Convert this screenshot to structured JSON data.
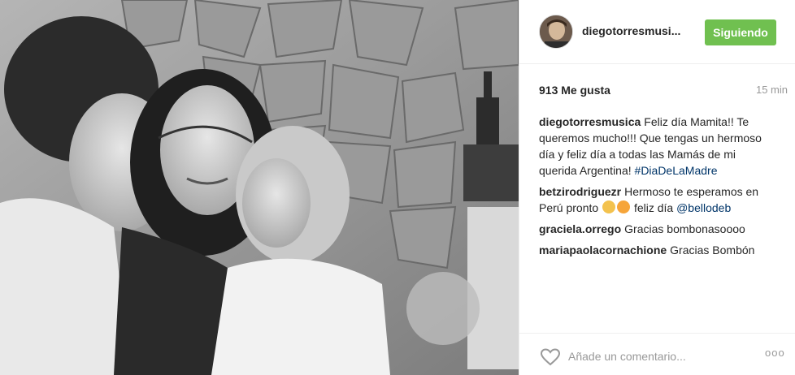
{
  "photo": {
    "description_icon": "photo"
  },
  "header": {
    "username": "diegotorresmusi...",
    "follow_label": "Siguiendo",
    "follow_color": "#70c050"
  },
  "stats": {
    "likes": "913 Me gusta",
    "time": "15 min"
  },
  "comments": [
    {
      "author": "diegotorresmusica",
      "text": "Feliz día Mamita!! Te queremos mucho!!! Que tengas un hermoso día y feliz día a todas las Mamás de mi querida Argentina!",
      "hashtag": "#DiaDeLaMadre"
    },
    {
      "author": "betzirodriguezr",
      "text_before": "Hermoso te esperamos en Perú pronto",
      "text_after": "feliz día",
      "mention": "@bellodeb"
    },
    {
      "author": "graciela.orrego",
      "text": "Gracias bombonasoooo"
    },
    {
      "author": "mariapaolacornachione",
      "text": "Gracias Bombón"
    }
  ],
  "footer": {
    "comment_placeholder": "Añade un comentario...",
    "more_label": "ooo",
    "heart_icon": "heart-outline"
  },
  "colors": {
    "link": "#003569",
    "muted": "#999999",
    "text": "#262626"
  }
}
